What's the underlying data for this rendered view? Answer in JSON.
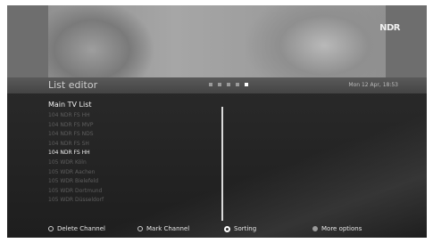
{
  "video": {
    "channel_logo": "NDR"
  },
  "header": {
    "title": "List editor",
    "page_dots": {
      "count": 5,
      "active_index": 4
    },
    "datetime": "Mon 12 Apr, 18:53"
  },
  "list": {
    "heading": "Main TV List",
    "rows": [
      {
        "label": "104 NDR FS HH",
        "active": false
      },
      {
        "label": "104 NDR FS MVP",
        "active": false
      },
      {
        "label": "104 NDR FS NDS",
        "active": false
      },
      {
        "label": "104 NDR FS SH",
        "active": false
      },
      {
        "label": "104 NDR FS HH",
        "active": true
      },
      {
        "label": "105 WDR Köln",
        "active": false
      },
      {
        "label": "105 WDR Aachen",
        "active": false
      },
      {
        "label": "105 WDR Bielefeld",
        "active": false
      },
      {
        "label": "105 WDR Dortmund",
        "active": false
      },
      {
        "label": "105 WDR Düsseldorf",
        "active": false
      }
    ]
  },
  "footer": {
    "delete": "Delete Channel",
    "mark": "Mark Channel",
    "sorting": "Sorting",
    "more": "More options"
  }
}
